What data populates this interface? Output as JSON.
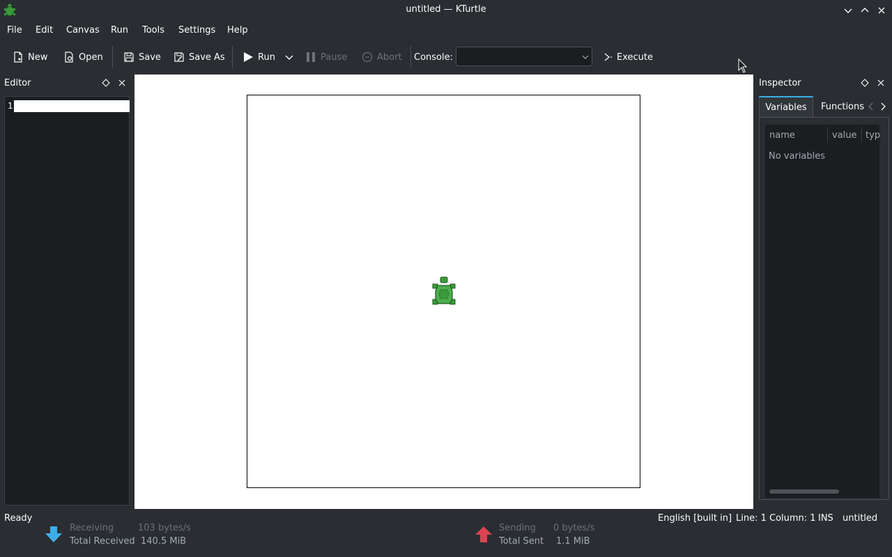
{
  "window": {
    "title": "untitled — KTurtle",
    "icon": "turtle-icon"
  },
  "menu": [
    "File",
    "Edit",
    "Canvas",
    "Run",
    "Tools",
    "Settings",
    "Help"
  ],
  "toolbar": {
    "new": "New",
    "open": "Open",
    "save": "Save",
    "save_as": "Save As",
    "run": "Run",
    "pause": "Pause",
    "abort": "Abort",
    "console_label": "Console:",
    "console_value": "",
    "execute": "Execute"
  },
  "editor": {
    "title": "Editor",
    "line_number": "1"
  },
  "inspector": {
    "title": "Inspector",
    "tabs": [
      "Variables",
      "Functions"
    ],
    "columns": [
      "name",
      "value",
      "typ"
    ],
    "empty_text": "No variables"
  },
  "status": {
    "left": "Ready",
    "language": "English [built in]",
    "position": "Line: 1 Column: 1",
    "mode": "INS",
    "file": "untitled"
  },
  "network": {
    "receiving_label": "Receiving",
    "receiving_rate": "103 bytes/s",
    "total_received_label": "Total Received",
    "total_received": "140.5 MiB",
    "sending_label": "Sending",
    "sending_rate": "0 bytes/s",
    "total_sent_label": "Total Sent",
    "total_sent": "1.1 MiB"
  },
  "colors": {
    "background": "#2a2e32",
    "accent": "#3daee9",
    "turtle_green": "#3a9a3a",
    "download_arrow": "#3daee9",
    "upload_arrow": "#da4453"
  }
}
